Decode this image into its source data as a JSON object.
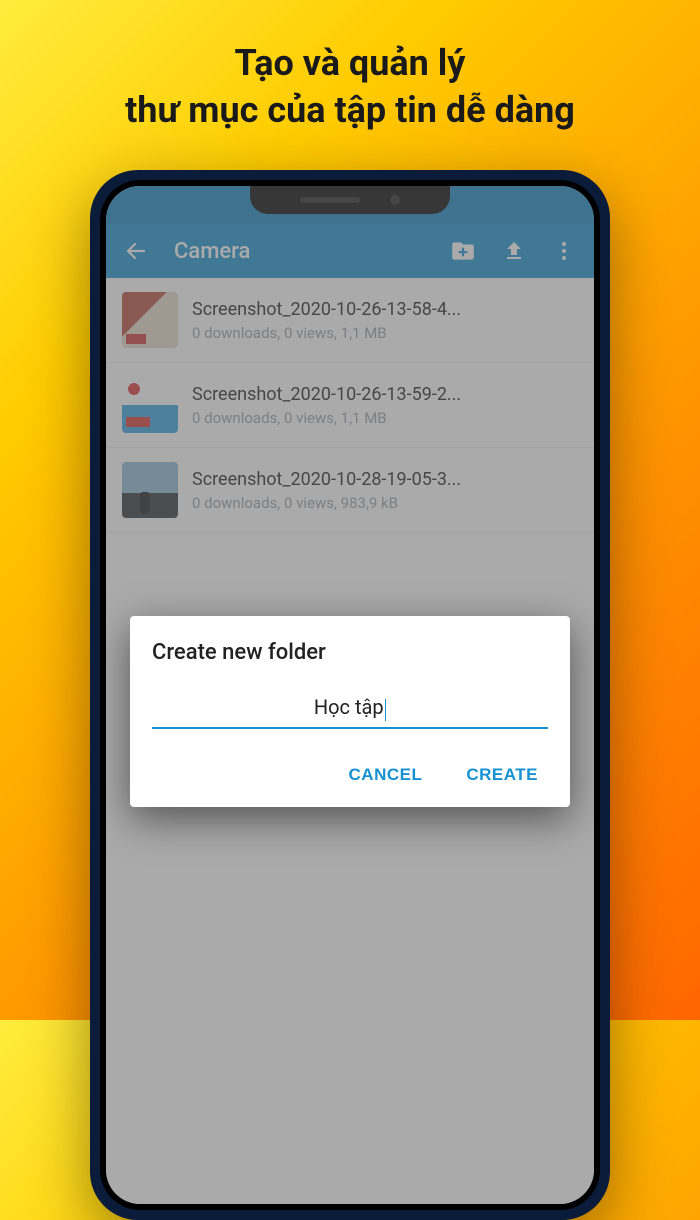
{
  "promo": {
    "line1": "Tạo và quản lý",
    "line2": "thư mục của tập tin dễ dàng"
  },
  "appbar": {
    "title": "Camera"
  },
  "files": [
    {
      "name": "Screenshot_2020-10-26-13-58-4...",
      "meta": "0 downloads, 0 views, 1,1 MB"
    },
    {
      "name": "Screenshot_2020-10-26-13-59-2...",
      "meta": "0 downloads, 0 views, 1,1 MB"
    },
    {
      "name": "Screenshot_2020-10-28-19-05-3...",
      "meta": "0 downloads, 0 views, 983,9 kB"
    }
  ],
  "dialog": {
    "title": "Create new folder",
    "input_value": "Học tập",
    "cancel_label": "CANCEL",
    "create_label": "CREATE"
  }
}
